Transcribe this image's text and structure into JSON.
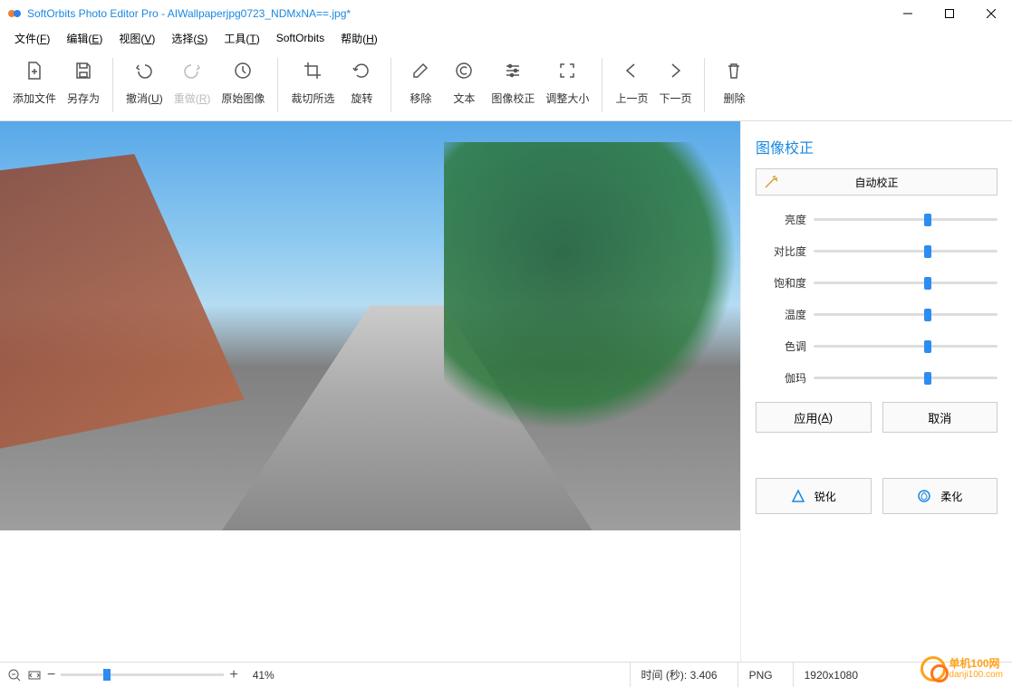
{
  "window": {
    "title": "SoftOrbits Photo Editor Pro - AIWallpaperjpg0723_NDMxNA==.jpg*"
  },
  "menu": {
    "file": "文件(F)",
    "edit": "编辑(E)",
    "view": "视图(V)",
    "select": "选择(S)",
    "tools": "工具(T)",
    "softorbits": "SoftOrbits",
    "help": "帮助(H)"
  },
  "toolbar": {
    "add_file": "添加文件",
    "save_as": "另存为",
    "undo": "撤消(U)",
    "redo": "重做(R)",
    "original": "原始图像",
    "crop": "裁切所选",
    "rotate": "旋转",
    "remove": "移除",
    "text": "文本",
    "image_correct": "图像校正",
    "resize": "调整大小",
    "prev": "上一页",
    "next": "下一页",
    "delete": "删除"
  },
  "panel": {
    "title": "图像校正",
    "auto": "自动校正",
    "brightness": "亮度",
    "contrast": "对比度",
    "saturation": "饱和度",
    "temperature": "温度",
    "tint": "色调",
    "gamma": "伽玛",
    "apply": "应用(A)",
    "cancel": "取消",
    "sharpen": "锐化",
    "soften": "柔化",
    "slider_positions": {
      "brightness": 62,
      "contrast": 62,
      "saturation": 62,
      "temperature": 62,
      "tint": 62,
      "gamma": 62
    }
  },
  "status": {
    "zoom_pct": "41%",
    "time_label": "时间 (秒):",
    "time_value": "3.406",
    "format": "PNG",
    "dims": "1920x1080"
  },
  "watermark": {
    "line1": "单机100网",
    "line2": "danji100.com"
  }
}
